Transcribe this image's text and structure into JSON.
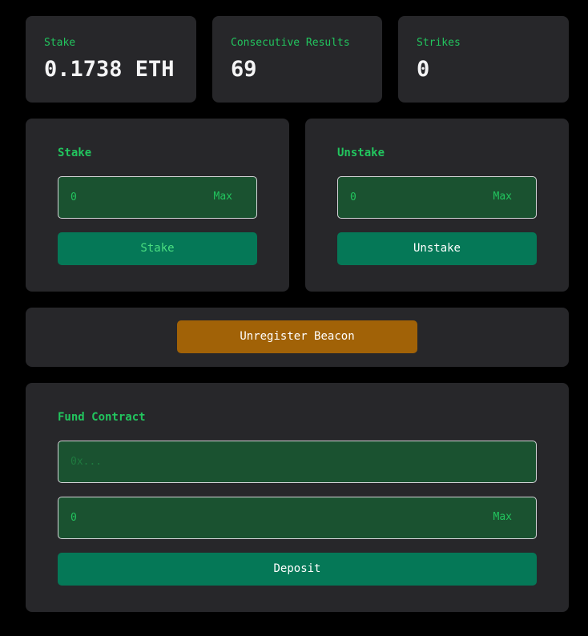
{
  "stats": [
    {
      "label": "Stake",
      "value": "0.1738 ETH"
    },
    {
      "label": "Consecutive Results",
      "value": "69"
    },
    {
      "label": "Strikes",
      "value": "0"
    }
  ],
  "stake_panel": {
    "title": "Stake",
    "amount_value": "0",
    "max_label": "Max",
    "button_label": "Stake"
  },
  "unstake_panel": {
    "title": "Unstake",
    "amount_value": "0",
    "max_label": "Max",
    "button_label": "Unstake"
  },
  "beacon": {
    "button_label": "Unregister Beacon"
  },
  "fund": {
    "title": "Fund Contract",
    "address_placeholder": "0x...",
    "amount_value": "0",
    "max_label": "Max",
    "button_label": "Deposit"
  },
  "colors": {
    "accent_green": "#22c55e",
    "button_teal": "#057857",
    "warning_orange": "#a16207",
    "card_bg": "#27272a"
  }
}
